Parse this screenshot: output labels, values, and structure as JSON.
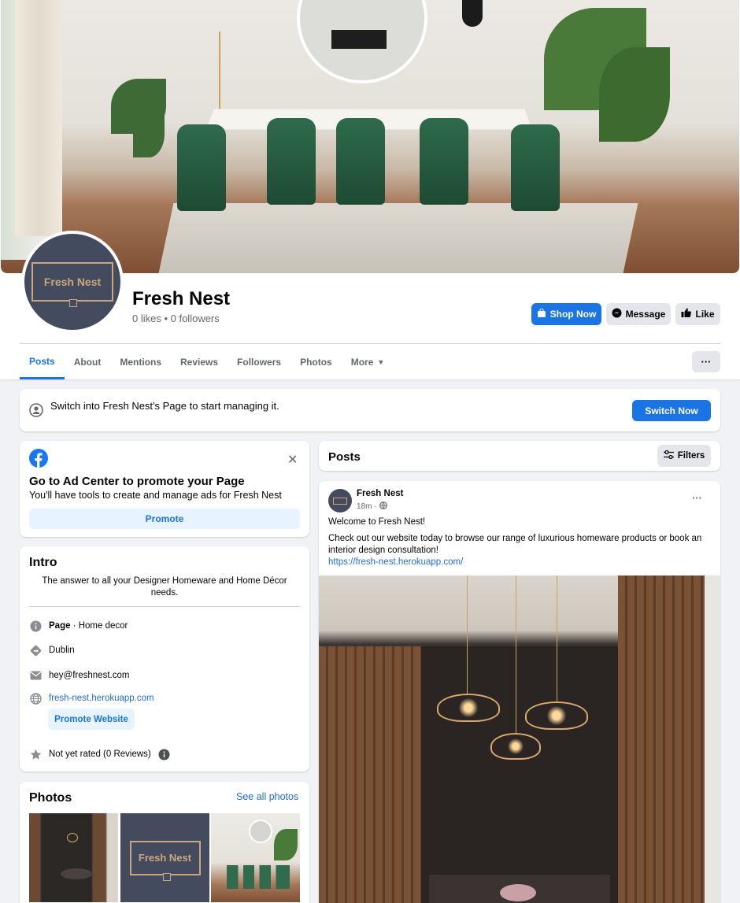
{
  "page": {
    "name": "Fresh Nest",
    "stats": "0 likes • 0 followers",
    "logo_text": "Fresh Nest"
  },
  "actions": {
    "shop_now": "Shop Now",
    "message": "Message",
    "like": "Like"
  },
  "tabs": [
    {
      "label": "Posts",
      "active": true
    },
    {
      "label": "About"
    },
    {
      "label": "Mentions"
    },
    {
      "label": "Reviews"
    },
    {
      "label": "Followers"
    },
    {
      "label": "Photos"
    },
    {
      "label": "More"
    }
  ],
  "more_button": "···",
  "switch_banner": {
    "text": "Switch into Fresh Nest's Page to start managing it.",
    "button": "Switch Now"
  },
  "ad_center": {
    "title": "Go to Ad Center to promote your Page",
    "subtitle": "You'll have tools to create and manage ads for Fresh Nest",
    "button": "Promote"
  },
  "intro": {
    "title": "Intro",
    "description": "The answer to all your Designer Homeware and Home Décor needs.",
    "category_bold": "Page",
    "category_rest": " · Home decor",
    "location": "Dublin",
    "email": "hey@freshnest.com",
    "website": "fresh-nest.herokuapp.com",
    "promote_website": "Promote Website",
    "rating": "Not yet rated (0 Reviews)"
  },
  "photos": {
    "title": "Photos",
    "see_all": "See all photos",
    "logo_text": "Fresh Nest"
  },
  "posts": {
    "title": "Posts",
    "filters": "Filters"
  },
  "post": {
    "author": "Fresh Nest",
    "time": "18m ·",
    "line1": "Welcome to Fresh Nest!",
    "line2": "Check out our website today to browse our range of luxurious homeware products or book an interior design consultation!",
    "link": "https://fresh-nest.herokuapp.com/",
    "menu": "···"
  },
  "colors": {
    "accent": "#1b74e4",
    "logo_bg": "#444b5e",
    "logo_gold": "#c9a77c"
  }
}
